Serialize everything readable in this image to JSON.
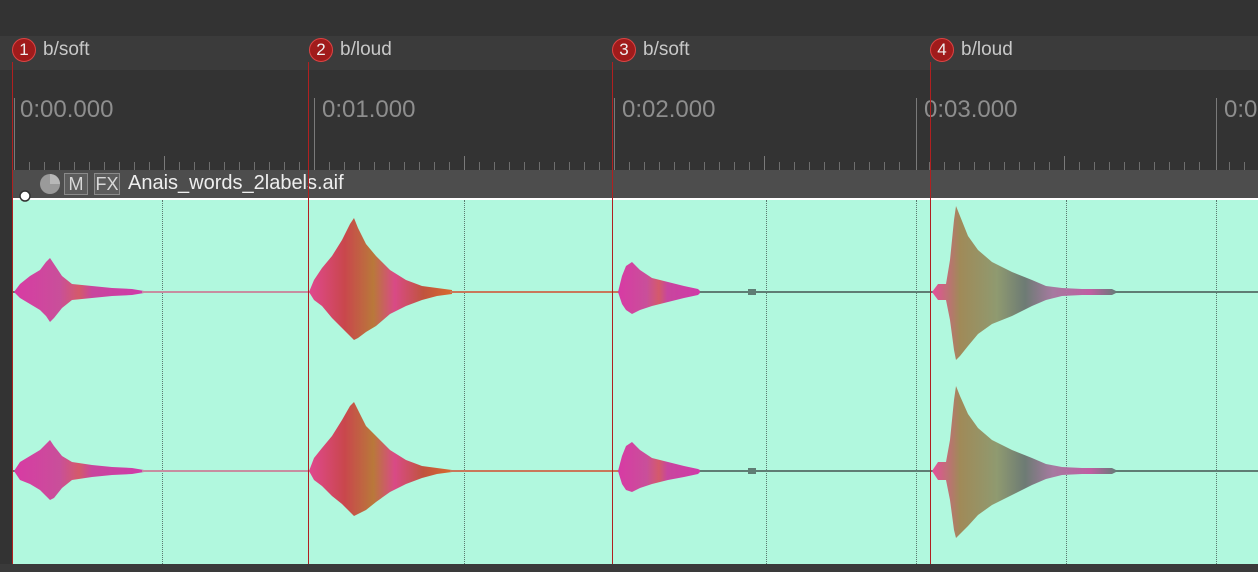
{
  "markers": [
    {
      "number": "1",
      "label": "b/soft"
    },
    {
      "number": "2",
      "label": "b/loud"
    },
    {
      "number": "3",
      "label": "b/soft"
    },
    {
      "number": "4",
      "label": "b/loud"
    }
  ],
  "ruler": {
    "time_labels": [
      "0:00.000",
      "0:01.000",
      "0:02.000",
      "0:03.000",
      "0:0"
    ]
  },
  "item": {
    "filename": "Anais_words_2labels.aif",
    "mute_label": "M",
    "fx_label": "FX"
  },
  "colors": {
    "background": "#333333",
    "item_body": "#b1f8de",
    "marker_red": "#a01b1b",
    "waveform_soft": "#d4449a",
    "waveform_loud": "#c77a3e"
  }
}
